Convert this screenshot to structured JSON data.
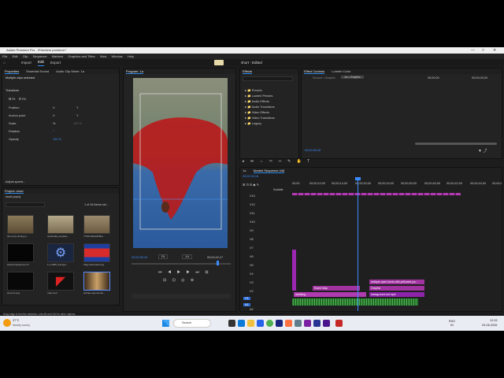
{
  "app": {
    "title": "Adobe Premiere Pro - \\Premiere pro\\short *",
    "menu": [
      "File",
      "Edit",
      "Clip",
      "Sequence",
      "Markers",
      "Graphics and Titles",
      "View",
      "Window",
      "Help"
    ],
    "workspaces": [
      "Import",
      "Edit",
      "Export"
    ],
    "active_workspace": "Edit",
    "project_title": "short - Edited"
  },
  "left_top": {
    "tabs": [
      "Properties",
      "Essential Sound",
      "Audio Clip Mixer: 1a"
    ],
    "selected": "Multiple clips selected",
    "section": "Transform",
    "fields": [
      {
        "label": "Position",
        "x": "X",
        "y": "Y"
      },
      {
        "label": "Anchor point",
        "x": "X",
        "y": "Y"
      },
      {
        "label": "Scale",
        "x": "%",
        "y": "100 %"
      },
      {
        "label": "Rotation",
        "x": "°",
        "y": ""
      },
      {
        "label": "Opacity",
        "x": "100 %",
        "y": ""
      }
    ],
    "adjust": "Adjust speed..."
  },
  "project": {
    "title": "Project: short",
    "file": "short.prproj",
    "count": "1 of 45 items sel...",
    "items": [
      {
        "name": "the-army-of-king-e...",
        "dur": "4;20"
      },
      {
        "name": "cambodia_temples...",
        "dur": "4;20"
      },
      {
        "name": "7742c1964e6b5be...",
        "dur": "4;20"
      },
      {
        "name": "Nested Sequence 07",
        "dur": "4;20"
      },
      {
        "name": "1-1-3356_franspa...",
        "dur": "4;20"
      },
      {
        "name": "Flag-Cambodia.svg",
        "dur": "4;20"
      },
      {
        "name": "arrow-3.png",
        "dur": "4;20"
      },
      {
        "name": "map.mp4",
        "dur": "4;20"
      },
      {
        "name": "antique-open-book...",
        "dur": "4;20"
      }
    ]
  },
  "program": {
    "title": "Program: 1a",
    "timecode": "00;00;35;18",
    "fit": "Fit",
    "ratio": "1/4",
    "duration": "00;00;42;17"
  },
  "effects": {
    "title": "Effects",
    "items": [
      "Presets",
      "Lumetri Presets",
      "Audio Effects",
      "Audio Transitions",
      "Video Effects",
      "Video Transitions",
      "Legacy"
    ]
  },
  "effect_controls": {
    "tabs": [
      "Effect Controls",
      "Lumetri Color"
    ],
    "source": "Source • Graphic",
    "target": "1a • Graphic",
    "time1": "00;00;00",
    "time2": "00;00;05;00",
    "timecode": "00;00;35;18"
  },
  "timeline": {
    "tabs": [
      "1a",
      "Nested Sequence 446"
    ],
    "timecode": "00;00;35;18",
    "ruler": [
      "00;00",
      "00;00;10;00",
      "00;00;14;00",
      "00;00;20;00",
      "00;00;24;00",
      "00;00;30;00",
      "00;00;40;00",
      "00;00;42;00",
      "00;00;44;00",
      "00;00;4"
    ],
    "subtitle": "Subtitle",
    "tracks": [
      "V13",
      "V12",
      "V11",
      "V10",
      "V9",
      "V8",
      "V7",
      "V6",
      "V5",
      "V4",
      "V3",
      "V2",
      "V1",
      "A1",
      "A2"
    ],
    "clips": {
      "ruled_map": "Ruled Map",
      "antique": "antique-open-book-with-yellowed-pa...",
      "graphic": "Graphic",
      "bg": "background sel.mp4",
      "wedding": "wedding"
    }
  },
  "status": "Drag edge to trim the selection. Use Alt and Ctrl for other options.",
  "taskbar": {
    "weather": "37°C",
    "weather_sub": "Mostly sunny",
    "search": "Search",
    "time": "12:33",
    "date": "03-06-2026",
    "lang": "ENG",
    "lang_sub": "IN"
  }
}
